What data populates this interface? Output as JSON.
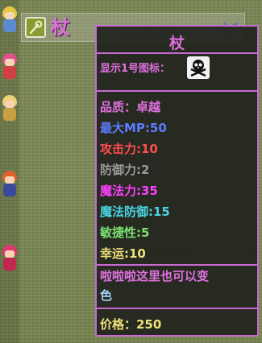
{
  "item": {
    "name": "杖",
    "icon": "staff-icon",
    "equip_icon": "bow-icon"
  },
  "tooltip": {
    "title": "杖",
    "icon_label": "显示1号图标：",
    "icon": "skull-crossbones-icon",
    "stats": [
      {
        "label": "品质：卓越",
        "color": "#e070e0"
      },
      {
        "label": "最大MP:50",
        "color": "#5d7bff"
      },
      {
        "label": "攻击力:10",
        "color": "#ff4d4d"
      },
      {
        "label": "防御力:2",
        "color": "#9a9a9a"
      },
      {
        "label": "魔法力:35",
        "color": "#ff40ff"
      },
      {
        "label": "魔法防御:15",
        "color": "#4ad6e6"
      },
      {
        "label": "敏捷性:5",
        "color": "#7ae070"
      },
      {
        "label": "幸运:10",
        "color": "#f2e07a"
      }
    ],
    "description_main": "啦啦啦这里也可以变",
    "description_tail": "色",
    "price": "价格：250"
  },
  "colors": {
    "accent": "#c86ad2",
    "title": "#e070e0",
    "price": "#f0e07a"
  }
}
